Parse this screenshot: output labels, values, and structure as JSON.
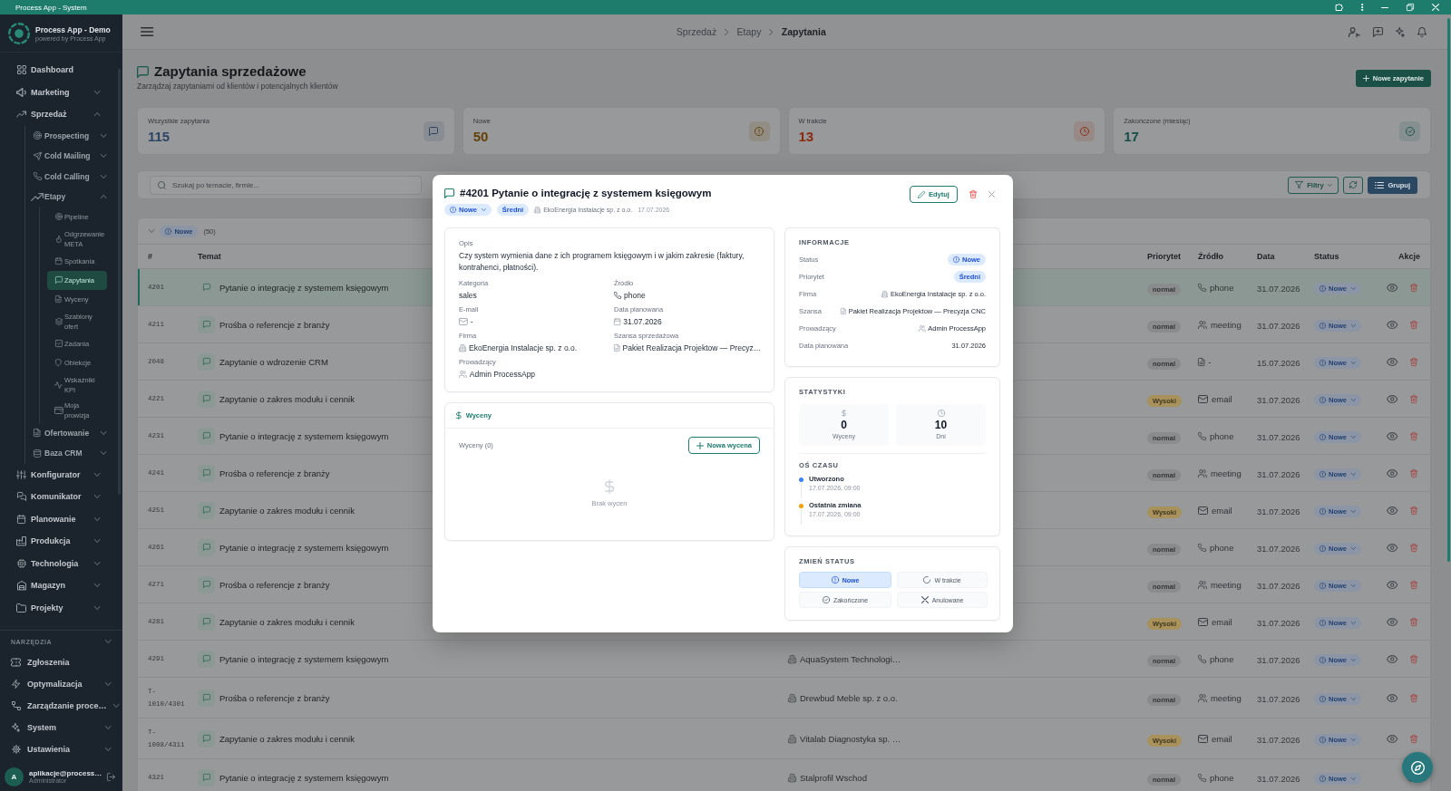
{
  "window": {
    "title": "Process App - System"
  },
  "sidebar": {
    "app_name": "Process App - Demo",
    "app_tagline": "powered by Process App",
    "items": [
      {
        "label": "Dashboard",
        "selected": false
      },
      {
        "label": "Marketing",
        "expanded": false,
        "selected": false
      },
      {
        "label": "Sprzedaż",
        "expanded": true,
        "selected": false,
        "children": [
          {
            "label": "Prospecting",
            "expanded": false,
            "selected": false
          },
          {
            "label": "Cold Mailing",
            "expanded": false,
            "selected": false
          },
          {
            "label": "Cold Calling",
            "expanded": false,
            "selected": false
          },
          {
            "label": "Etapy",
            "expanded": true,
            "selected": false,
            "children": [
              {
                "label": "Pipeline",
                "selected": false
              },
              {
                "label": "Odgrzewanie META",
                "selected": false
              },
              {
                "label": "Spotkania",
                "selected": false
              },
              {
                "label": "Zapytania",
                "selected": true
              },
              {
                "label": "Wyceny",
                "selected": false
              },
              {
                "label": "Szablony ofert",
                "selected": false
              },
              {
                "label": "Zadania",
                "selected": false
              },
              {
                "label": "Obiekcje",
                "selected": false
              },
              {
                "label": "Wskaźniki KPI",
                "selected": false
              },
              {
                "label": "Moja prowizja",
                "selected": false
              }
            ]
          },
          {
            "label": "Ofertowanie",
            "expanded": false,
            "selected": false
          },
          {
            "label": "Baza CRM",
            "expanded": false,
            "selected": false
          }
        ]
      },
      {
        "label": "Konfigurator",
        "expanded": false,
        "selected": false
      },
      {
        "label": "Komunikator",
        "expanded": false,
        "selected": false
      },
      {
        "label": "Planowanie",
        "expanded": false,
        "selected": false
      },
      {
        "label": "Produkcja",
        "expanded": false,
        "selected": false
      },
      {
        "label": "Technologia",
        "expanded": false,
        "selected": false
      },
      {
        "label": "Magazyn",
        "expanded": false,
        "selected": false
      },
      {
        "label": "Projekty",
        "expanded": false,
        "selected": false
      }
    ],
    "tools": {
      "title": "NARZĘDZIA",
      "expanded": true,
      "items": [
        {
          "label": "Zgłoszenia",
          "selected": false
        },
        {
          "label": "Optymalizacja",
          "expanded": false,
          "selected": false
        },
        {
          "label": "Zarządzanie proce…",
          "expanded": false,
          "selected": false
        },
        {
          "label": "System",
          "expanded": false,
          "selected": false
        },
        {
          "label": "Ustawienia",
          "expanded": false,
          "selected": false
        }
      ]
    },
    "user": {
      "avatar_letter": "A",
      "name": "aplikacje@process…",
      "role": "Administrator"
    }
  },
  "topbar": {
    "breadcrumbs": [
      {
        "label": "Sprzedaż",
        "current": false
      },
      {
        "label": "Etapy",
        "current": false
      },
      {
        "label": "Zapytania",
        "current": true
      }
    ]
  },
  "page": {
    "title": "Zapytania sprzedażowe",
    "subtitle": "Zarządzaj zapytaniami od klientów i potencjalnych klientów",
    "new_button": "Nowe zapytanie"
  },
  "stats": [
    {
      "label": "Wszystkie zapytania",
      "value": "115",
      "color": "#2c4566"
    },
    {
      "label": "Nowe",
      "value": "50",
      "color": "#634005"
    },
    {
      "label": "W trakcie",
      "value": "13",
      "color": "#8a2a10"
    },
    {
      "label": "Zakończone (miesiąc)",
      "value": "17",
      "color": "#17504a"
    }
  ],
  "toolbar": {
    "search": {
      "placeholder": "Szukaj po temacie, firmie..."
    },
    "filter_button": "Filtry",
    "group_button": "Grupuj"
  },
  "table": {
    "group": {
      "status": "Nowe",
      "count": "(50)",
      "expanded": true
    },
    "columns": [
      {
        "label": "#"
      },
      {
        "label": "Temat"
      },
      {
        "label": "Priorytet"
      },
      {
        "label": "Źródło"
      },
      {
        "label": "Data"
      },
      {
        "label": "Status"
      },
      {
        "label": "Akcje"
      }
    ],
    "rows": [
      {
        "id": "4201",
        "subject": "Pytanie o integrację z systemem księgowym",
        "priority": {
          "label": "normal",
          "color": "#8a8b8c"
        },
        "source": {
          "kind": "phone",
          "label": "phone"
        },
        "date": "31.07.2026",
        "status": "Nowe",
        "selected": true
      },
      {
        "id": "4211",
        "subject": "Prośba o referencje z branży",
        "priority": {
          "label": "normal",
          "color": "#8a8b8c"
        },
        "source": {
          "kind": "meeting",
          "label": "meeting"
        },
        "date": "31.07.2026",
        "status": "Nowe",
        "selected": false
      },
      {
        "id": "2048",
        "subject": "Zapytanie o wdrozenie CRM",
        "priority": {
          "label": "normal",
          "color": "#8a8b8c"
        },
        "source": {
          "kind": "other",
          "label": "-"
        },
        "date": "15.07.2026",
        "status": "Nowe",
        "selected": false
      },
      {
        "id": "4221",
        "subject": "Zapytanie o zakres modułu i cennik",
        "priority": {
          "label": "Wysoki",
          "color": "#a8915a"
        },
        "source": {
          "kind": "email",
          "label": "email"
        },
        "date": "31.07.2026",
        "status": "Nowe",
        "selected": false
      },
      {
        "id": "4231",
        "subject": "Pytanie o integrację z systemem księgowym",
        "priority": {
          "label": "normal",
          "color": "#8a8b8c"
        },
        "source": {
          "kind": "phone",
          "label": "phone"
        },
        "date": "31.07.2026",
        "status": "Nowe",
        "selected": false
      },
      {
        "id": "4241",
        "subject": "Prośba o referencje z branży",
        "priority": {
          "label": "normal",
          "color": "#8a8b8c"
        },
        "source": {
          "kind": "meeting",
          "label": "meeting"
        },
        "date": "31.07.2026",
        "status": "Nowe",
        "selected": false
      },
      {
        "id": "4251",
        "subject": "Zapytanie o zakres modułu i cennik",
        "priority": {
          "label": "Wysoki",
          "color": "#a8915a"
        },
        "source": {
          "kind": "email",
          "label": "email"
        },
        "date": "31.07.2026",
        "status": "Nowe",
        "selected": false
      },
      {
        "id": "4261",
        "subject": "Pytanie o integrację z systemem księgowym",
        "priority": {
          "label": "normal",
          "color": "#8a8b8c"
        },
        "source": {
          "kind": "phone",
          "label": "phone"
        },
        "date": "31.07.2026",
        "status": "Nowe",
        "selected": false
      },
      {
        "id": "4271",
        "subject": "Prośba o referencje z branży",
        "priority": {
          "label": "normal",
          "color": "#8a8b8c"
        },
        "source": {
          "kind": "meeting",
          "label": "meeting"
        },
        "date": "31.07.2026",
        "status": "Nowe",
        "selected": false
      },
      {
        "id": "4281",
        "subject": "Zapytanie o zakres modułu i cennik",
        "priority": {
          "label": "Wysoki",
          "color": "#a8915a"
        },
        "source": {
          "kind": "email",
          "label": "email"
        },
        "date": "31.07.2026",
        "status": "Nowe",
        "selected": false
      },
      {
        "id": "4291",
        "subject": "Pytanie o integrację z systemem księgowym",
        "company": "AquaSystem Technologi…",
        "priority": {
          "label": "normal",
          "color": "#8a8b8c"
        },
        "source": {
          "kind": "phone",
          "label": "phone"
        },
        "date": "31.07.2026",
        "status": "Nowe",
        "selected": false
      },
      {
        "id": "T-1010/4301",
        "subject": "Prośba o referencje z branży",
        "company": "Drewbud Meble sp. z o.o.",
        "priority": {
          "label": "normal",
          "color": "#8a8b8c"
        },
        "source": {
          "kind": "meeting",
          "label": "meeting"
        },
        "date": "31.07.2026",
        "status": "Nowe",
        "selected": false
      },
      {
        "id": "T-1008/4311",
        "subject": "Zapytanie o zakres modułu i cennik",
        "company": "Vitalab Diagnostyka sp. …",
        "priority": {
          "label": "Wysoki",
          "color": "#a8915a"
        },
        "source": {
          "kind": "email",
          "label": "email"
        },
        "date": "31.07.2026",
        "status": "Nowe",
        "selected": false
      },
      {
        "id": "4321",
        "subject": "Pytanie o integrację z systemem księgowym",
        "company": "Stalprofil Wschod",
        "priority": {
          "label": "normal",
          "color": "#8a8b8c"
        },
        "source": {
          "kind": "phone",
          "label": "phone"
        },
        "date": "31.07.2026",
        "status": "Nowe",
        "selected": false
      }
    ]
  },
  "modal": {
    "title": "#4201 Pytanie o integrację z systemem księgowym",
    "status": "Nowe",
    "priority": "Średni",
    "company": "EkoEnergia Instalacje sp. z o.o.",
    "date": "17.07.2026",
    "edit_button": "Edytuj",
    "details": {
      "description_label": "Opis",
      "description": "Czy system wymienia dane z ich programem księgowym i w jakim zakresie (faktury, kontrahenci, płatności).",
      "fields": [
        {
          "label": "Kategoria",
          "value": "sales",
          "kind": "text"
        },
        {
          "label": "Źródło",
          "value": "phone",
          "kind": "phone"
        },
        {
          "label": "E-mail",
          "value": "-",
          "kind": "email"
        },
        {
          "label": "Data planowana",
          "value": "31.07.2026",
          "kind": "date"
        },
        {
          "label": "Firma",
          "value": "EkoEnergia Instalacje sp. z o.o.",
          "kind": "company"
        },
        {
          "label": "Szansa sprzedażowa",
          "value": "Pakiet Realizacja Projektow — Precyz…",
          "kind": "opportunity"
        },
        {
          "label": "Prowadzący",
          "value": "Admin ProcessApp",
          "kind": "person"
        }
      ]
    },
    "quotes": {
      "title": "Wyceny",
      "count_label": "Wyceny (0)",
      "new_button": "Nowa wycena",
      "empty_text": "Brak wycen"
    },
    "info": {
      "title": "INFORMACJE",
      "rows": [
        {
          "label": "Status",
          "value": "Nowe",
          "kind": "status"
        },
        {
          "label": "Priorytet",
          "value": "Średni",
          "kind": "priority"
        },
        {
          "label": "Firma",
          "value": "EkoEnergia Instalacje sp. z o.o.",
          "kind": "company"
        },
        {
          "label": "Szansa",
          "value": "Pakiet Realizacja Projektow — Precyzja CNC",
          "kind": "opportunity"
        },
        {
          "label": "Prowadzący",
          "value": "Admin ProcessApp",
          "kind": "person"
        },
        {
          "label": "Data planowana",
          "value": "31.07.2026",
          "kind": "text"
        }
      ]
    },
    "stats": {
      "title": "STATYSTYKI",
      "tiles": [
        {
          "value": "0",
          "label": "Wyceny",
          "kind": "money"
        },
        {
          "value": "10",
          "label": "Dni",
          "kind": "time"
        }
      ]
    },
    "timeline": {
      "title": "OŚ CZASU",
      "events": [
        {
          "label": "Utworzono",
          "time": "17.07.2026, 09:00",
          "color": "#3b82f6"
        },
        {
          "label": "Ostatnia zmiana",
          "time": "17.07.2026, 09:00",
          "color": "#f59e0b"
        }
      ]
    },
    "status_change": {
      "title": "ZMIEŃ STATUS",
      "options": [
        {
          "label": "Nowe",
          "kind": "new",
          "selected": true
        },
        {
          "label": "W trakcie",
          "kind": "progress",
          "selected": false
        },
        {
          "label": "Zakończone",
          "kind": "done",
          "selected": false
        },
        {
          "label": "Anulowane",
          "kind": "cancelled",
          "selected": false
        }
      ]
    }
  }
}
